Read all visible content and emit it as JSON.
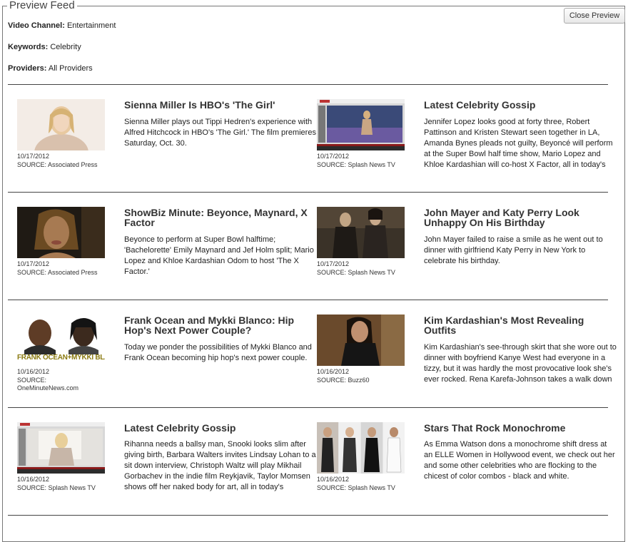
{
  "legend": "Preview Feed",
  "meta": {
    "channel_label": "Video Channel:",
    "channel_value": "Entertainment",
    "keywords_label": "Keywords:",
    "keywords_value": "Celebrity",
    "providers_label": "Providers:",
    "providers_value": "All Providers"
  },
  "close_button": "Close Preview",
  "items": [
    {
      "title": "Sienna Miller Is HBO's 'The Girl'",
      "desc": "Sienna Miller plays out Tippi Hedren's experience with Alfred Hitchcock in HBO's 'The Girl.' The film premieres Saturday, Oct. 30.",
      "date": "10/17/2012",
      "source": "SOURCE: Associated Press",
      "thumb": "portrait-blonde-woman"
    },
    {
      "title": "Latest Celebrity Gossip",
      "desc": "Jennifer Lopez looks good at forty three, Robert Pattinson and Kristen Stewart seen together in LA, Amanda Bynes pleads not guilty, Beyoncé will perform at the Super Bowl half time show, Mario Lopez and Khloe Kardashian will co-host X Factor, all in today's",
      "date": "10/17/2012",
      "source": "SOURCE: Splash News TV",
      "thumb": "video-player-stage"
    },
    {
      "title": "ShowBiz Minute: Beyonce, Maynard, X Factor",
      "desc": "Beyonce to perform at Super Bowl halftime; 'Bachelorette' Emily Maynard and Jef Holm split; Mario Lopez and Khloe Kardashian Odom to host 'The X Factor.'",
      "date": "10/17/2012",
      "source": "SOURCE: Associated Press",
      "thumb": "portrait-woman-dark"
    },
    {
      "title": "John Mayer and Katy Perry Look Unhappy On His Birthday",
      "desc": "John Mayer failed to raise a smile as he went out to dinner with girlfriend Katy Perry in New York to celebrate his birthday.",
      "date": "10/17/2012",
      "source": "SOURCE: Splash News TV",
      "thumb": "couple-street"
    },
    {
      "title": "Frank Ocean and Mykki Blanco: Hip Hop's Next Power Couple?",
      "desc": "Today we ponder the possibilities of Mykki Blanco and Frank Ocean becoming hip hop's next power couple.",
      "date": "10/16/2012",
      "source": "SOURCE: OneMinuteNews.com",
      "thumb": "two-faces",
      "thumb_caption": "FRANK OCEAN+MYKKI BLANCO"
    },
    {
      "title": "Kim Kardashian's Most Revealing Outfits",
      "desc": "Kim Kardashian's see-through skirt that she wore out to dinner with boyfriend Kanye West had everyone in a tizzy, but it was hardly the most provocative look she's ever rocked. Rena Karefa-Johnson takes a walk down",
      "date": "10/16/2012",
      "source": "SOURCE: Buzz60",
      "thumb": "woman-black-outfit"
    },
    {
      "title": "Latest Celebrity Gossip",
      "desc": "Rihanna needs a ballsy man, Snooki looks slim after giving birth, Barbara Walters invites Lindsay Lohan to a sit down interview, Christoph Waltz will play Mikhail Gorbachev in the indie film Reykjavik, Taylor Momsen shows off her naked body for art, all in today's",
      "date": "10/16/2012",
      "source": "SOURCE: Splash News TV",
      "thumb": "video-player-blonde"
    },
    {
      "title": "Stars That Rock Monochrome",
      "desc": "As Emma Watson dons a monochrome shift dress at an ELLE Women in Hollywood event, we check out her and some other celebrities who are flocking to the chicest of color combos - black and white.",
      "date": "10/16/2012",
      "source": "SOURCE: Splash News TV",
      "thumb": "collage-celebrities"
    }
  ]
}
